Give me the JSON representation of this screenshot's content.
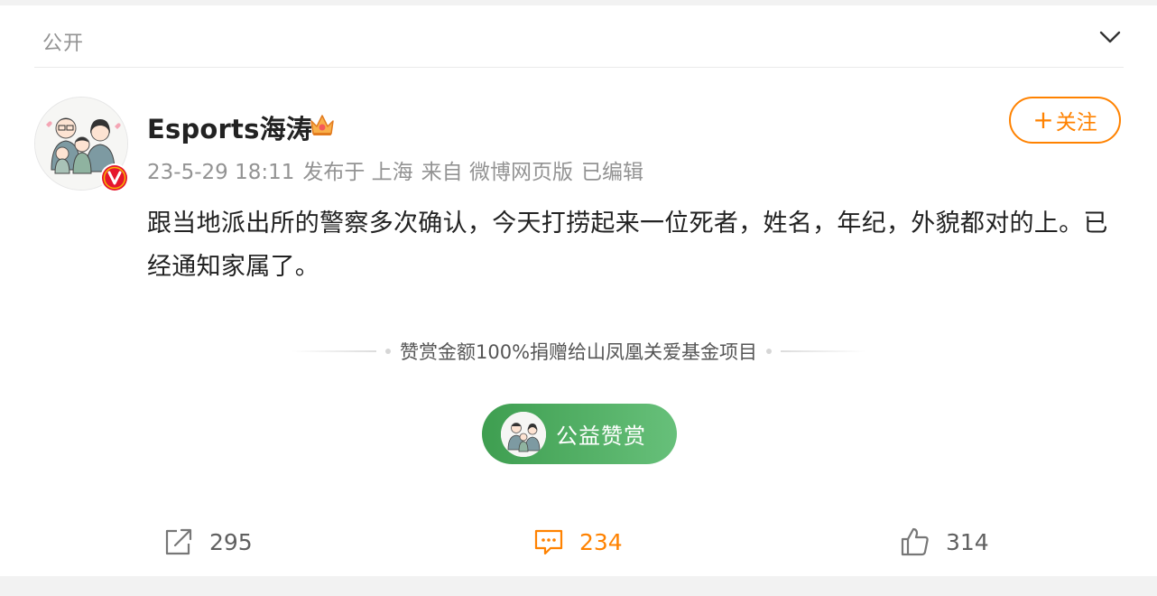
{
  "post": {
    "visibility": "公开",
    "author": {
      "name": "Esports海涛",
      "badge_icon": "crown-icon",
      "verified_icon": "v-verified-icon"
    },
    "meta": {
      "time": "23-5-29 18:11",
      "location": "发布于 上海",
      "source": "来自 微博网页版",
      "edited": "已编辑"
    },
    "follow_button": {
      "plus": "+",
      "label": "关注"
    },
    "content": "跟当地派出所的警察多次确认，今天打捞起来一位死者，姓名，年纪，外貌都对的上。已经通知家属了。",
    "donation": {
      "note": "赞赏金额100%捐赠给山凤凰关爱基金项目",
      "button_label": "公益赞赏"
    },
    "actions": {
      "repost_count": "295",
      "comment_count": "234",
      "like_count": "314"
    },
    "colors": {
      "accent_orange": "#ff8200",
      "donate_green": "#4caf60",
      "verified_red": "#e6162d"
    }
  }
}
